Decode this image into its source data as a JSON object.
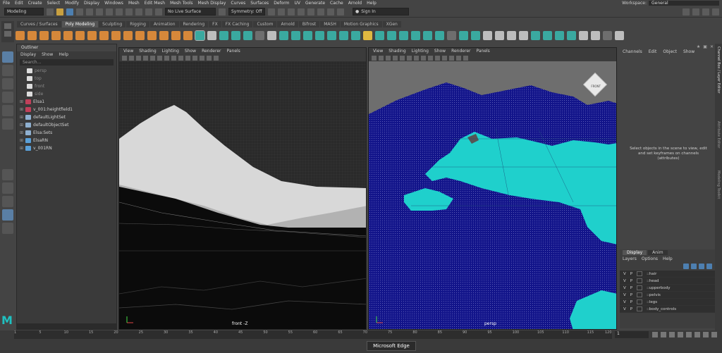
{
  "menubar": {
    "items": [
      "File",
      "Edit",
      "Create",
      "Select",
      "Modify",
      "Display",
      "Windows",
      "Mesh",
      "Edit Mesh",
      "Mesh Tools",
      "Mesh Display",
      "Curves",
      "Surfaces",
      "Deform",
      "UV",
      "Generate",
      "Cache",
      "Arnold",
      "Help"
    ],
    "workspace_label": "Workspace:",
    "workspace_value": "General"
  },
  "statusline": {
    "mode": "Modeling",
    "live_surface": "No Live Surface",
    "symmetry": "Symmetry: Off",
    "signin": "Sign In"
  },
  "shelf_tabs": [
    "Curves / Surfaces",
    "Poly Modeling",
    "Sculpting",
    "Rigging",
    "Animation",
    "Rendering",
    "FX",
    "FX Caching",
    "Custom",
    "Arnold",
    "Bifrost",
    "MASH",
    "Motion Graphics",
    "XGen"
  ],
  "shelf_active": "Poly Modeling",
  "outliner": {
    "title": "Outliner",
    "menu": [
      "Display",
      "Show",
      "Help"
    ],
    "search_placeholder": "Search...",
    "items": [
      {
        "label": "persp",
        "dim": true,
        "icon": "camera-icon"
      },
      {
        "label": "top",
        "dim": true,
        "icon": "camera-icon"
      },
      {
        "label": "front",
        "dim": true,
        "icon": "camera-icon"
      },
      {
        "label": "side",
        "dim": true,
        "icon": "camera-icon"
      },
      {
        "label": "Elsa1",
        "dim": false,
        "icon": "mesh-icon"
      },
      {
        "label": "v_001:heightfield1",
        "dim": false,
        "icon": "mesh-icon"
      },
      {
        "label": "defaultLightSet",
        "dim": false,
        "icon": "set-icon"
      },
      {
        "label": "defaultObjectSet",
        "dim": false,
        "icon": "set-icon"
      },
      {
        "label": "Elsa:Sets",
        "dim": false,
        "icon": "set-icon"
      },
      {
        "label": "ElsaRN",
        "dim": false,
        "icon": "reference-icon"
      },
      {
        "label": "v_001RN",
        "dim": false,
        "icon": "reference-icon"
      }
    ]
  },
  "viewport_menu": [
    "View",
    "Shading",
    "Lighting",
    "Show",
    "Renderer",
    "Panels"
  ],
  "viewport_front": {
    "label": "front -Z"
  },
  "viewport_persp": {
    "label": "persp",
    "cube_label": "FRONT"
  },
  "channels": {
    "menu": [
      "Channels",
      "Edit",
      "Object",
      "Show"
    ],
    "message": "Select objects in the scene to view, edit and set keyframes on channels (attributes)"
  },
  "side_tabs": [
    "Channel Box / Layer Editor",
    "Attribute Editor",
    "Modeling Toolkit"
  ],
  "layers": {
    "tabs": [
      "Display",
      "Anim"
    ],
    "menu": [
      "Layers",
      "Options",
      "Help"
    ],
    "rows": [
      {
        "v": "V",
        "p": "P",
        "name": "::hair"
      },
      {
        "v": "V",
        "p": "P",
        "name": "::head"
      },
      {
        "v": "V",
        "p": "P",
        "name": "::upperbody"
      },
      {
        "v": "V",
        "p": "P",
        "name": "::pelvis"
      },
      {
        "v": "V",
        "p": "P",
        "name": "::legs"
      },
      {
        "v": "V",
        "p": "P",
        "name": "::body_controls"
      }
    ]
  },
  "timeline": {
    "ticks": [
      "1",
      "5",
      "10",
      "15",
      "20",
      "25",
      "30",
      "35",
      "40",
      "45",
      "50",
      "55",
      "60",
      "65",
      "70",
      "75",
      "80",
      "85",
      "90",
      "95",
      "100",
      "105",
      "110",
      "115",
      "120"
    ],
    "current_frame": "1"
  },
  "taskbar_tooltip": "Microsoft Edge",
  "colors": {
    "water": "#12148a",
    "terrain": "#1fd0cc",
    "accent": "#4d7fb0"
  }
}
